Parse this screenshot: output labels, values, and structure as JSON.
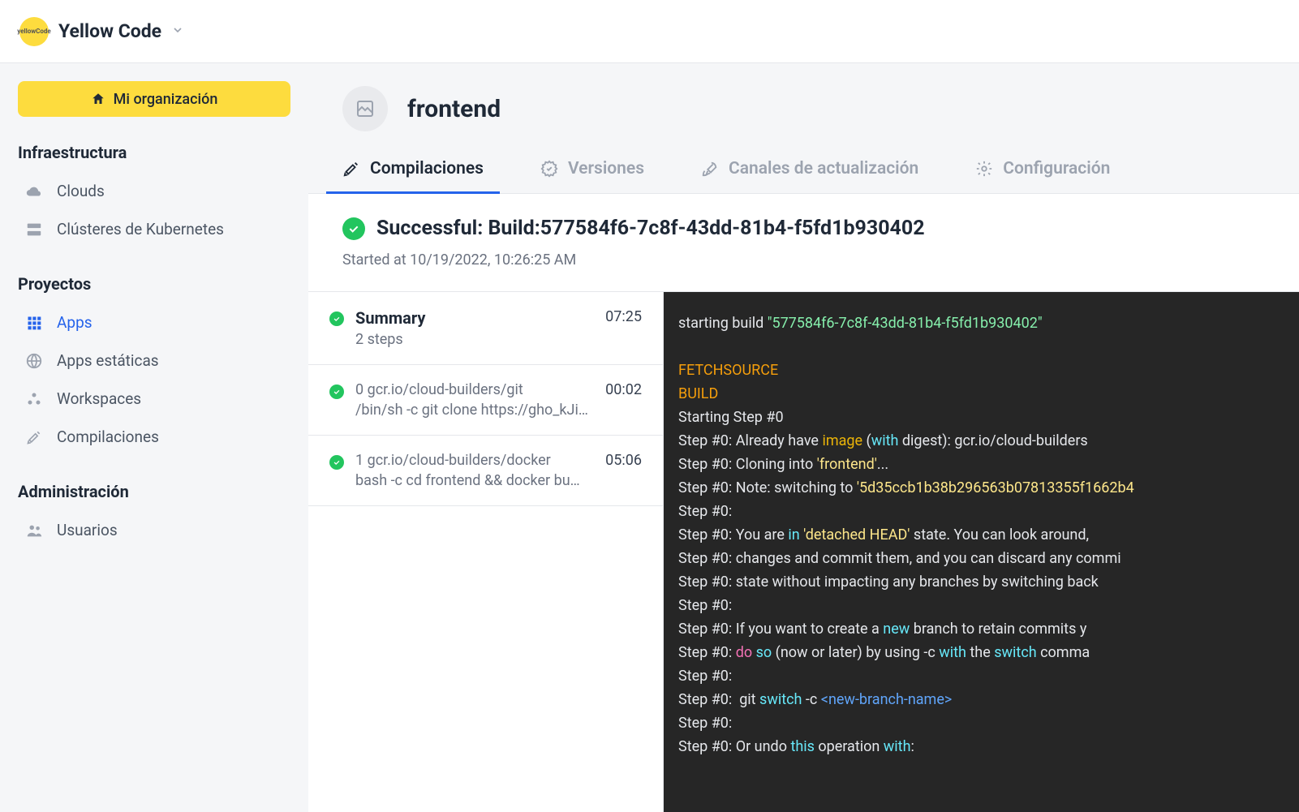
{
  "header": {
    "org_name": "Yellow Code"
  },
  "sidebar": {
    "primary_button": "Mi organización",
    "sections": {
      "infra": {
        "title": "Infraestructura",
        "clouds": "Clouds",
        "k8s": "Clústeres de Kubernetes"
      },
      "projects": {
        "title": "Proyectos",
        "apps": "Apps",
        "static_apps": "Apps estáticas",
        "workspaces": "Workspaces",
        "builds": "Compilaciones"
      },
      "admin": {
        "title": "Administración",
        "users": "Usuarios"
      }
    }
  },
  "page": {
    "title": "frontend"
  },
  "tabs": {
    "builds": "Compilaciones",
    "versions": "Versiones",
    "channels": "Canales de actualización",
    "config": "Configuración"
  },
  "build": {
    "status_prefix": "Successful: ",
    "title": "Build:577584f6-7c8f-43dd-81b4-f5fd1b930402",
    "started_at": "Started at 10/19/2022, 10:26:25 AM"
  },
  "steps": {
    "summary": {
      "title": "Summary",
      "subtitle": "2 steps",
      "time": "07:25"
    },
    "s0": {
      "title": "0 gcr.io/cloud-builders/git",
      "subtitle": "/bin/sh -c git clone https://gho_kJi…",
      "time": "00:02"
    },
    "s1": {
      "title": "1 gcr.io/cloud-builders/docker",
      "subtitle": "bash -c cd frontend && docker bu…",
      "time": "05:06"
    }
  },
  "log": {
    "l1": "starting build ",
    "l1_id": "\"577584f6-7c8f-43dd-81b4-f5fd1b930402\"",
    "l3": "FETCHSOURCE",
    "l4": "BUILD",
    "l5": "Starting Step #0",
    "step_prefix": "Step #0",
    "already_have": ": Already have ",
    "image": "image",
    "with": "with",
    "digest": " digest",
    "builder": ": gcr.io/cloud-builders",
    "cloning": ": Cloning into ",
    "frontend_q": "'frontend'",
    "dots": "...",
    "note": ": Note",
    "switching": ": switching to ",
    "commit": "'5d35ccb1b38b296563b07813355f1662b4",
    "you_are": ": You are ",
    "in": "in",
    "detached": " 'detached HEAD'",
    "state": " state",
    "look": ". You can look around,",
    "changes": ": changes and commit them, and you can discard any commi",
    "state_without": ": state without impacting any branches by switching back",
    "if_want": ": If you want to create a ",
    "new": "new",
    "branch_retain": " branch to retain commits y",
    "do": "do",
    "so": " so",
    "now_later": " (now or later) by using -c ",
    "the": " the ",
    "switch": "switch",
    "comma": " comma",
    "git_sw": ":  git ",
    "switch2": "switch",
    "dash_c": " -c ",
    "branch_name": "<new-branch-name>",
    "undo": ": Or undo ",
    "this": "this",
    "operation": " operation ",
    "with2": "with",
    "colon2": ":"
  }
}
